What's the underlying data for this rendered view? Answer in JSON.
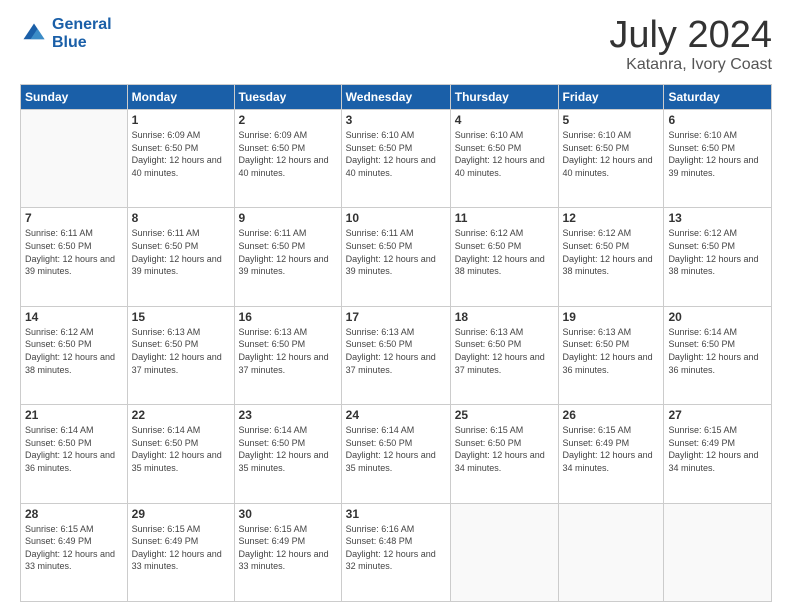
{
  "header": {
    "logo_line1": "General",
    "logo_line2": "Blue",
    "month": "July 2024",
    "location": "Katanra, Ivory Coast"
  },
  "weekdays": [
    "Sunday",
    "Monday",
    "Tuesday",
    "Wednesday",
    "Thursday",
    "Friday",
    "Saturday"
  ],
  "weeks": [
    [
      {
        "day": "",
        "sunrise": "",
        "sunset": "",
        "daylight": ""
      },
      {
        "day": "1",
        "sunrise": "Sunrise: 6:09 AM",
        "sunset": "Sunset: 6:50 PM",
        "daylight": "Daylight: 12 hours and 40 minutes."
      },
      {
        "day": "2",
        "sunrise": "Sunrise: 6:09 AM",
        "sunset": "Sunset: 6:50 PM",
        "daylight": "Daylight: 12 hours and 40 minutes."
      },
      {
        "day": "3",
        "sunrise": "Sunrise: 6:10 AM",
        "sunset": "Sunset: 6:50 PM",
        "daylight": "Daylight: 12 hours and 40 minutes."
      },
      {
        "day": "4",
        "sunrise": "Sunrise: 6:10 AM",
        "sunset": "Sunset: 6:50 PM",
        "daylight": "Daylight: 12 hours and 40 minutes."
      },
      {
        "day": "5",
        "sunrise": "Sunrise: 6:10 AM",
        "sunset": "Sunset: 6:50 PM",
        "daylight": "Daylight: 12 hours and 40 minutes."
      },
      {
        "day": "6",
        "sunrise": "Sunrise: 6:10 AM",
        "sunset": "Sunset: 6:50 PM",
        "daylight": "Daylight: 12 hours and 39 minutes."
      }
    ],
    [
      {
        "day": "7",
        "sunrise": "Sunrise: 6:11 AM",
        "sunset": "Sunset: 6:50 PM",
        "daylight": "Daylight: 12 hours and 39 minutes."
      },
      {
        "day": "8",
        "sunrise": "Sunrise: 6:11 AM",
        "sunset": "Sunset: 6:50 PM",
        "daylight": "Daylight: 12 hours and 39 minutes."
      },
      {
        "day": "9",
        "sunrise": "Sunrise: 6:11 AM",
        "sunset": "Sunset: 6:50 PM",
        "daylight": "Daylight: 12 hours and 39 minutes."
      },
      {
        "day": "10",
        "sunrise": "Sunrise: 6:11 AM",
        "sunset": "Sunset: 6:50 PM",
        "daylight": "Daylight: 12 hours and 39 minutes."
      },
      {
        "day": "11",
        "sunrise": "Sunrise: 6:12 AM",
        "sunset": "Sunset: 6:50 PM",
        "daylight": "Daylight: 12 hours and 38 minutes."
      },
      {
        "day": "12",
        "sunrise": "Sunrise: 6:12 AM",
        "sunset": "Sunset: 6:50 PM",
        "daylight": "Daylight: 12 hours and 38 minutes."
      },
      {
        "day": "13",
        "sunrise": "Sunrise: 6:12 AM",
        "sunset": "Sunset: 6:50 PM",
        "daylight": "Daylight: 12 hours and 38 minutes."
      }
    ],
    [
      {
        "day": "14",
        "sunrise": "Sunrise: 6:12 AM",
        "sunset": "Sunset: 6:50 PM",
        "daylight": "Daylight: 12 hours and 38 minutes."
      },
      {
        "day": "15",
        "sunrise": "Sunrise: 6:13 AM",
        "sunset": "Sunset: 6:50 PM",
        "daylight": "Daylight: 12 hours and 37 minutes."
      },
      {
        "day": "16",
        "sunrise": "Sunrise: 6:13 AM",
        "sunset": "Sunset: 6:50 PM",
        "daylight": "Daylight: 12 hours and 37 minutes."
      },
      {
        "day": "17",
        "sunrise": "Sunrise: 6:13 AM",
        "sunset": "Sunset: 6:50 PM",
        "daylight": "Daylight: 12 hours and 37 minutes."
      },
      {
        "day": "18",
        "sunrise": "Sunrise: 6:13 AM",
        "sunset": "Sunset: 6:50 PM",
        "daylight": "Daylight: 12 hours and 37 minutes."
      },
      {
        "day": "19",
        "sunrise": "Sunrise: 6:13 AM",
        "sunset": "Sunset: 6:50 PM",
        "daylight": "Daylight: 12 hours and 36 minutes."
      },
      {
        "day": "20",
        "sunrise": "Sunrise: 6:14 AM",
        "sunset": "Sunset: 6:50 PM",
        "daylight": "Daylight: 12 hours and 36 minutes."
      }
    ],
    [
      {
        "day": "21",
        "sunrise": "Sunrise: 6:14 AM",
        "sunset": "Sunset: 6:50 PM",
        "daylight": "Daylight: 12 hours and 36 minutes."
      },
      {
        "day": "22",
        "sunrise": "Sunrise: 6:14 AM",
        "sunset": "Sunset: 6:50 PM",
        "daylight": "Daylight: 12 hours and 35 minutes."
      },
      {
        "day": "23",
        "sunrise": "Sunrise: 6:14 AM",
        "sunset": "Sunset: 6:50 PM",
        "daylight": "Daylight: 12 hours and 35 minutes."
      },
      {
        "day": "24",
        "sunrise": "Sunrise: 6:14 AM",
        "sunset": "Sunset: 6:50 PM",
        "daylight": "Daylight: 12 hours and 35 minutes."
      },
      {
        "day": "25",
        "sunrise": "Sunrise: 6:15 AM",
        "sunset": "Sunset: 6:50 PM",
        "daylight": "Daylight: 12 hours and 34 minutes."
      },
      {
        "day": "26",
        "sunrise": "Sunrise: 6:15 AM",
        "sunset": "Sunset: 6:49 PM",
        "daylight": "Daylight: 12 hours and 34 minutes."
      },
      {
        "day": "27",
        "sunrise": "Sunrise: 6:15 AM",
        "sunset": "Sunset: 6:49 PM",
        "daylight": "Daylight: 12 hours and 34 minutes."
      }
    ],
    [
      {
        "day": "28",
        "sunrise": "Sunrise: 6:15 AM",
        "sunset": "Sunset: 6:49 PM",
        "daylight": "Daylight: 12 hours and 33 minutes."
      },
      {
        "day": "29",
        "sunrise": "Sunrise: 6:15 AM",
        "sunset": "Sunset: 6:49 PM",
        "daylight": "Daylight: 12 hours and 33 minutes."
      },
      {
        "day": "30",
        "sunrise": "Sunrise: 6:15 AM",
        "sunset": "Sunset: 6:49 PM",
        "daylight": "Daylight: 12 hours and 33 minutes."
      },
      {
        "day": "31",
        "sunrise": "Sunrise: 6:16 AM",
        "sunset": "Sunset: 6:48 PM",
        "daylight": "Daylight: 12 hours and 32 minutes."
      },
      {
        "day": "",
        "sunrise": "",
        "sunset": "",
        "daylight": ""
      },
      {
        "day": "",
        "sunrise": "",
        "sunset": "",
        "daylight": ""
      },
      {
        "day": "",
        "sunrise": "",
        "sunset": "",
        "daylight": ""
      }
    ]
  ]
}
